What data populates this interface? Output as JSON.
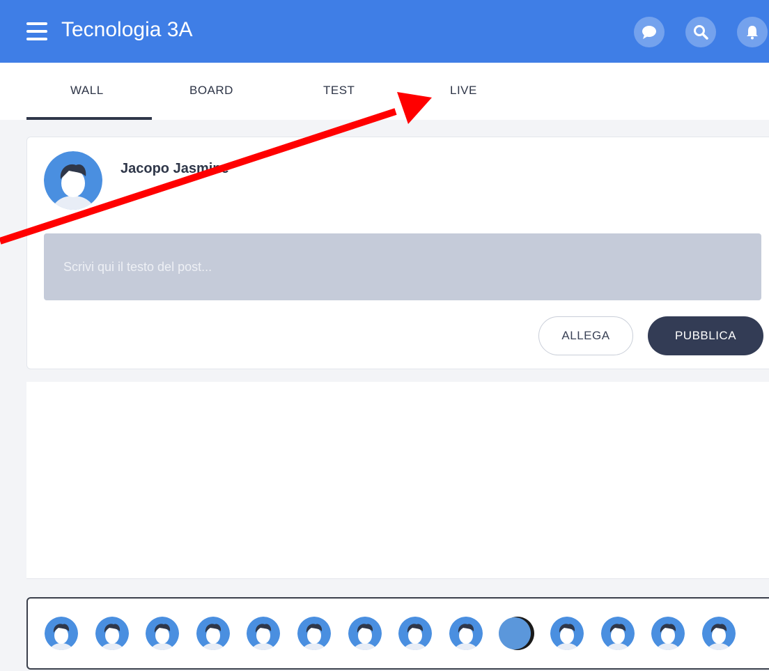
{
  "app": {
    "title": "Tecnologia 3A"
  },
  "header_icons": [
    "chat-icon",
    "search-icon",
    "bell-icon"
  ],
  "tabs": [
    {
      "label": "WALL",
      "active": true
    },
    {
      "label": "BOARD",
      "active": false
    },
    {
      "label": "TEST",
      "active": false
    },
    {
      "label": "LIVE",
      "active": false
    }
  ],
  "composer": {
    "author": "Jacopo Jasmine",
    "placeholder": "Scrivi qui il testo del post...",
    "attach_label": "ALLEGA",
    "publish_label": "PUBBLICA"
  },
  "participants": {
    "count": 14,
    "highlighted_index": 9
  },
  "colors": {
    "header": "#3f7ee6",
    "tab_active": "#2f3749",
    "publish": "#333c55",
    "avatar": "#4a8fe0",
    "annotation_arrow": "#ff0000"
  }
}
